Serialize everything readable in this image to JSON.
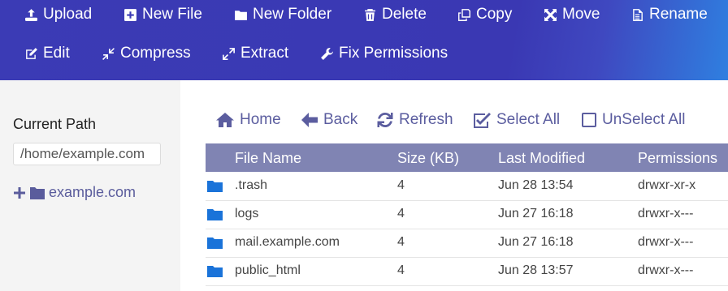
{
  "toolbar": {
    "upload": "Upload",
    "new_file": "New File",
    "new_folder": "New Folder",
    "delete": "Delete",
    "copy": "Copy",
    "move": "Move",
    "rename": "Rename",
    "edit": "Edit",
    "compress": "Compress",
    "extract": "Extract",
    "fix_permissions": "Fix Permissions"
  },
  "sidebar": {
    "current_path_label": "Current Path",
    "current_path_value": "/home/example.com",
    "tree_root": "example.com"
  },
  "nav": {
    "home": "Home",
    "back": "Back",
    "refresh": "Refresh",
    "select_all": "Select All",
    "unselect_all": "UnSelect All"
  },
  "table": {
    "columns": [
      "File Name",
      "Size (KB)",
      "Last Modified",
      "Permissions"
    ],
    "rows": [
      {
        "name": ".trash",
        "size": "4",
        "modified": "Jun 28 13:54",
        "permissions": "drwxr-xr-x"
      },
      {
        "name": "logs",
        "size": "4",
        "modified": "Jun 27 16:18",
        "permissions": "drwxr-x---"
      },
      {
        "name": "mail.example.com",
        "size": "4",
        "modified": "Jun 27 16:18",
        "permissions": "drwxr-x---"
      },
      {
        "name": "public_html",
        "size": "4",
        "modified": "Jun 28 13:57",
        "permissions": "drwxr-x---"
      }
    ]
  },
  "icons": {
    "upload": "upload-icon",
    "new_file": "plus-square-icon",
    "new_folder": "folder-icon",
    "delete": "trash-icon",
    "copy": "copy-icon",
    "move": "move-arrows-icon",
    "rename": "document-icon",
    "edit": "edit-icon",
    "compress": "compress-icon",
    "extract": "expand-icon",
    "fix_permissions": "wrench-icon",
    "home": "home-icon",
    "back": "arrow-left-icon",
    "refresh": "refresh-icon",
    "select_all": "checked-box-icon",
    "unselect_all": "empty-box-icon",
    "folder": "folder-icon"
  },
  "colors": {
    "toolbar_bg": "#3b3bb5",
    "toolbar_accent": "#2f7fe0",
    "table_header_bg": "#8084b3",
    "link": "#5b5d9f",
    "folder": "#1a73d9"
  }
}
